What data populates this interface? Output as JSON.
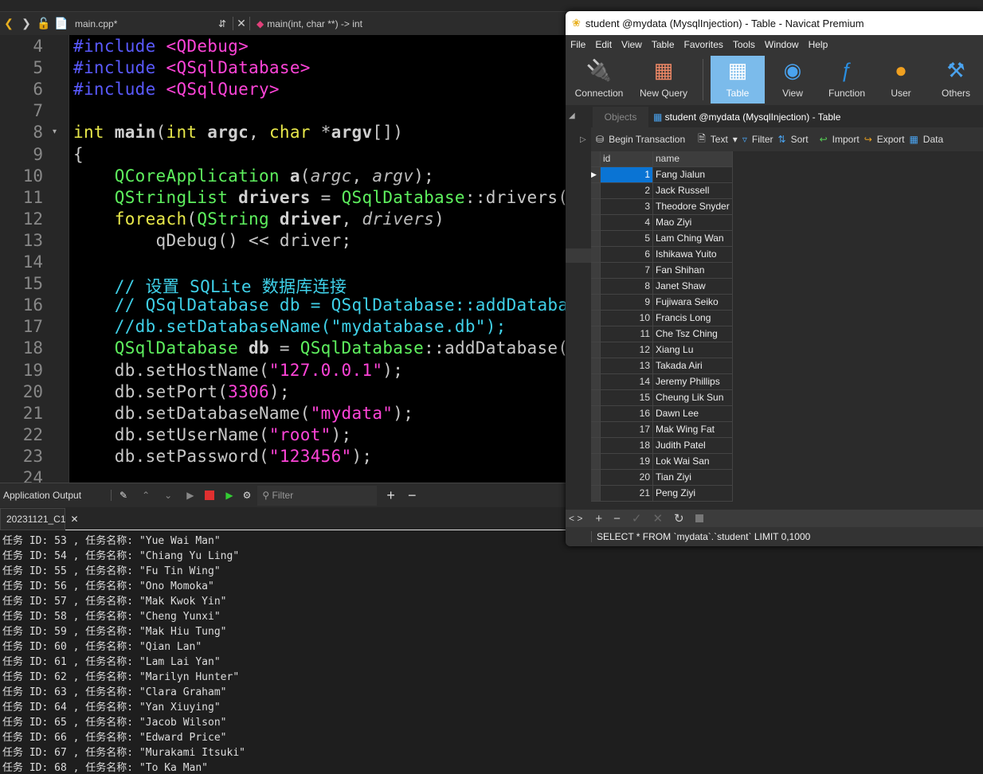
{
  "editor": {
    "file_name": "main.cpp*",
    "function_crumb": "main(int, char **) -> int",
    "lines": [
      {
        "n": "4",
        "tokens": [
          [
            "pp",
            "#include "
          ],
          [
            "inc",
            "<QDebug>"
          ]
        ]
      },
      {
        "n": "5",
        "tokens": [
          [
            "pp",
            "#include "
          ],
          [
            "inc",
            "<QSqlDatabase>"
          ]
        ]
      },
      {
        "n": "6",
        "tokens": [
          [
            "pp",
            "#include "
          ],
          [
            "inc",
            "<QSqlQuery>"
          ]
        ]
      },
      {
        "n": "7",
        "tokens": []
      },
      {
        "n": "8",
        "tokens": [
          [
            "kw",
            "int "
          ],
          [
            "bold",
            "main"
          ],
          [
            "",
            "("
          ],
          [
            "kw",
            "int "
          ],
          [
            "bold",
            "argc"
          ],
          [
            "",
            ", "
          ],
          [
            "kw",
            "char "
          ],
          [
            "",
            "*"
          ],
          [
            "bold",
            "argv"
          ],
          [
            "",
            "[])"
          ]
        ]
      },
      {
        "n": "9",
        "tokens": [
          [
            "",
            "{"
          ]
        ]
      },
      {
        "n": "10",
        "tokens": [
          [
            "",
            "    "
          ],
          [
            "type",
            "QCoreApplication "
          ],
          [
            "bold",
            "a"
          ],
          [
            "",
            "("
          ],
          [
            "it",
            "argc"
          ],
          [
            "",
            ", "
          ],
          [
            "it",
            "argv"
          ],
          [
            "",
            ");"
          ]
        ]
      },
      {
        "n": "11",
        "tokens": [
          [
            "",
            "    "
          ],
          [
            "type",
            "QStringList "
          ],
          [
            "bold",
            "drivers"
          ],
          [
            "",
            " = "
          ],
          [
            "type",
            "QSqlDatabase"
          ],
          [
            "",
            "::drivers("
          ]
        ]
      },
      {
        "n": "12",
        "tokens": [
          [
            "",
            "    "
          ],
          [
            "kw",
            "foreach"
          ],
          [
            "",
            "("
          ],
          [
            "type",
            "QString "
          ],
          [
            "bold",
            "driver"
          ],
          [
            "",
            ", "
          ],
          [
            "it",
            "drivers"
          ],
          [
            "",
            ")"
          ]
        ]
      },
      {
        "n": "13",
        "tokens": [
          [
            "",
            "        qDebug() << driver;"
          ]
        ]
      },
      {
        "n": "14",
        "tokens": []
      },
      {
        "n": "15",
        "tokens": [
          [
            "",
            "    "
          ],
          [
            "cm",
            "// 设置 SQLite 数据库连接"
          ]
        ]
      },
      {
        "n": "16",
        "tokens": [
          [
            "",
            "    "
          ],
          [
            "cm",
            "// QSqlDatabase db = QSqlDatabase::addDataba"
          ]
        ]
      },
      {
        "n": "17",
        "tokens": [
          [
            "",
            "    "
          ],
          [
            "cm",
            "//db.setDatabaseName(\"mydatabase.db\");"
          ]
        ]
      },
      {
        "n": "18",
        "tokens": [
          [
            "",
            "    "
          ],
          [
            "type",
            "QSqlDatabase "
          ],
          [
            "bold",
            "db"
          ],
          [
            "",
            " = "
          ],
          [
            "type",
            "QSqlDatabase"
          ],
          [
            "",
            "::addDatabase("
          ]
        ]
      },
      {
        "n": "19",
        "tokens": [
          [
            "",
            "    db.setHostName("
          ],
          [
            "str",
            "\"127.0.0.1\""
          ],
          [
            "",
            ");"
          ]
        ]
      },
      {
        "n": "20",
        "tokens": [
          [
            "",
            "    db.setPort("
          ],
          [
            "num",
            "3306"
          ],
          [
            "",
            ");"
          ]
        ]
      },
      {
        "n": "21",
        "tokens": [
          [
            "",
            "    db.setDatabaseName("
          ],
          [
            "str",
            "\"mydata\""
          ],
          [
            "",
            ");"
          ]
        ]
      },
      {
        "n": "22",
        "tokens": [
          [
            "",
            "    db.setUserName("
          ],
          [
            "str",
            "\"root\""
          ],
          [
            "",
            ");"
          ]
        ]
      },
      {
        "n": "23",
        "tokens": [
          [
            "",
            "    db.setPassword("
          ],
          [
            "str",
            "\"123456\""
          ],
          [
            "",
            ");"
          ]
        ]
      },
      {
        "n": "24",
        "tokens": []
      }
    ]
  },
  "output": {
    "title": "Application Output",
    "filter_placeholder": "Filter",
    "tab": "20231121_C1",
    "lines": [
      "任务 ID: 53 , 任务名称: \"Yue Wai Man\"",
      "任务 ID: 54 , 任务名称: \"Chiang Yu Ling\"",
      "任务 ID: 55 , 任务名称: \"Fu Tin Wing\"",
      "任务 ID: 56 , 任务名称: \"Ono Momoka\"",
      "任务 ID: 57 , 任务名称: \"Mak Kwok Yin\"",
      "任务 ID: 58 , 任务名称: \"Cheng Yunxi\"",
      "任务 ID: 59 , 任务名称: \"Mak Hiu Tung\"",
      "任务 ID: 60 , 任务名称: \"Qian Lan\"",
      "任务 ID: 61 , 任务名称: \"Lam Lai Yan\"",
      "任务 ID: 62 , 任务名称: \"Marilyn Hunter\"",
      "任务 ID: 63 , 任务名称: \"Clara Graham\"",
      "任务 ID: 64 , 任务名称: \"Yan Xiuying\"",
      "任务 ID: 65 , 任务名称: \"Jacob Wilson\"",
      "任务 ID: 66 , 任务名称: \"Edward Price\"",
      "任务 ID: 67 , 任务名称: \"Murakami Itsuki\"",
      "任务 ID: 68 , 任务名称: \"To Ka Man\""
    ]
  },
  "navicat": {
    "title": "student @mydata (MysqlInjection) - Table - Navicat Premium",
    "menu": [
      "File",
      "Edit",
      "View",
      "Table",
      "Favorites",
      "Tools",
      "Window",
      "Help"
    ],
    "toolbar": [
      "Connection",
      "New Query",
      "Table",
      "View",
      "Function",
      "User",
      "Others"
    ],
    "tabs": {
      "objects": "Objects",
      "active": "student @mydata (MysqlInjection) - Table"
    },
    "subtoolbar": {
      "begin": "Begin Transaction",
      "text": "Text",
      "filter": "Filter",
      "sort": "Sort",
      "import": "Import",
      "export": "Export",
      "data": "Data"
    },
    "columns": [
      "id",
      "name"
    ],
    "rows": [
      [
        "1",
        "Fang Jialun"
      ],
      [
        "2",
        "Jack Russell"
      ],
      [
        "3",
        "Theodore Snyder"
      ],
      [
        "4",
        "Mao Ziyi"
      ],
      [
        "5",
        "Lam Ching Wan"
      ],
      [
        "6",
        "Ishikawa Yuito"
      ],
      [
        "7",
        "Fan Shihan"
      ],
      [
        "8",
        "Janet Shaw"
      ],
      [
        "9",
        "Fujiwara Seiko"
      ],
      [
        "10",
        "Francis Long"
      ],
      [
        "11",
        "Che Tsz Ching"
      ],
      [
        "12",
        "Xiang Lu"
      ],
      [
        "13",
        "Takada Airi"
      ],
      [
        "14",
        "Jeremy Phillips"
      ],
      [
        "15",
        "Cheung Lik Sun"
      ],
      [
        "16",
        "Dawn Lee"
      ],
      [
        "17",
        "Mak Wing Fat"
      ],
      [
        "18",
        "Judith Patel"
      ],
      [
        "19",
        "Lok Wai San"
      ],
      [
        "20",
        "Tian Ziyi"
      ],
      [
        "21",
        "Peng Ziyi"
      ]
    ],
    "selected_row": 1,
    "sql": "SELECT * FROM `mydata`.`student` LIMIT 0,1000",
    "accent": "#0a74d4"
  }
}
